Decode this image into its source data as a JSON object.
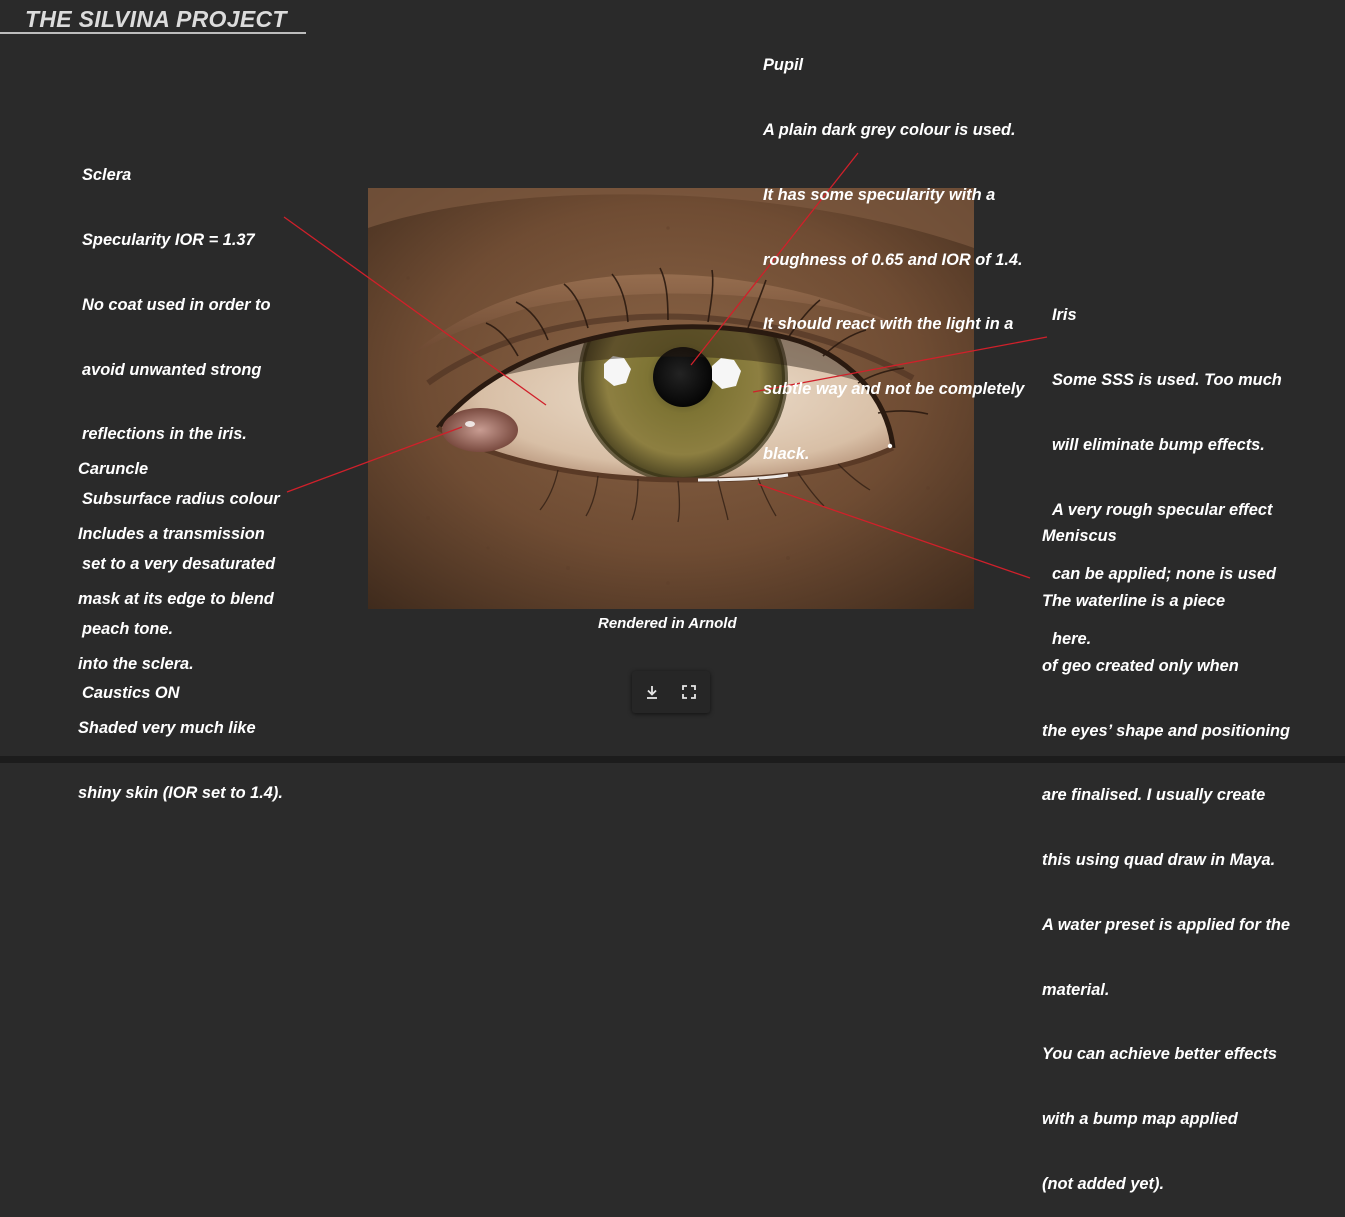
{
  "title": "THE SILVINA PROJECT",
  "caption": "Rendered in Arnold",
  "notes": {
    "pupil": [
      "Pupil",
      "A plain dark grey colour is used.",
      "It has some specularity with a",
      "roughness of 0.65 and IOR of 1.4.",
      "It should react with the light in a",
      "subtle way and not be completely",
      "black."
    ],
    "sclera": [
      "Sclera",
      "Specularity IOR = 1.37",
      "No coat used in order to",
      "avoid unwanted strong",
      "reflections in the iris.",
      "Subsurface radius colour",
      "set to a very desaturated",
      "peach tone.",
      "Caustics ON"
    ],
    "iris": [
      "Iris",
      "Some SSS is used. Too much",
      "will eliminate bump effects.",
      "A very rough specular effect",
      "can be applied; none is used",
      "here."
    ],
    "caruncle": [
      "Caruncle",
      "Includes a transmission",
      "mask at its edge to blend",
      "into the sclera.",
      "Shaded very much like",
      "shiny skin (IOR set to 1.4)."
    ],
    "meniscus": [
      "Meniscus",
      "The waterline is a piece",
      "of geo created only when",
      "the eyes’ shape and positioning",
      "are finalised. I usually create",
      "this using quad draw in Maya.",
      "A water preset is applied for the",
      "material.",
      "You can achieve better effects",
      "with a bump map applied",
      "(not added yet)."
    ]
  },
  "toolbar": {
    "buttons": [
      {
        "icon": "download-icon"
      },
      {
        "icon": "fullscreen-icon"
      }
    ]
  },
  "colors": {
    "background": "#2a2a2a",
    "leader_line": "#d0202a",
    "text": "#ffffff"
  }
}
